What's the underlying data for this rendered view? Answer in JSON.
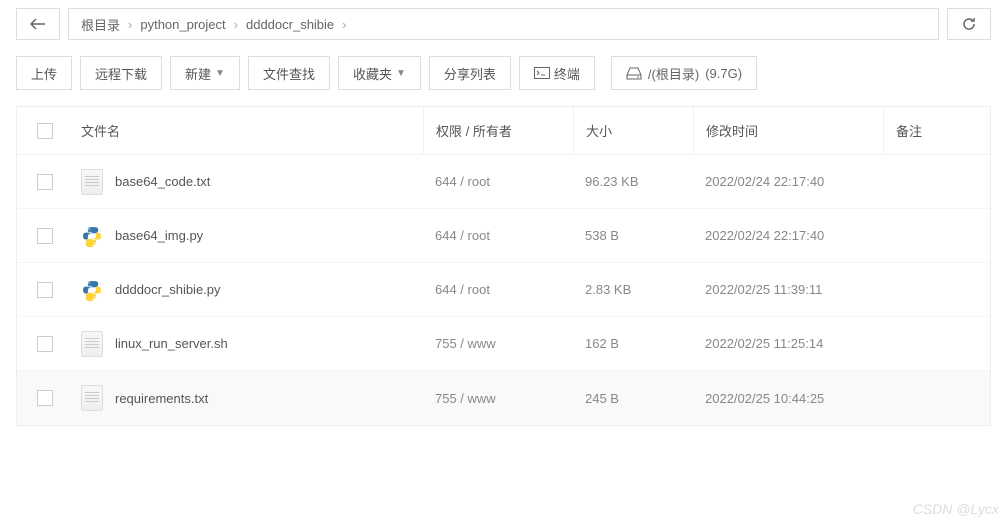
{
  "breadcrumb": {
    "root": "根目录",
    "items": [
      "python_project",
      "ddddocr_shibie"
    ]
  },
  "toolbar": {
    "upload": "上传",
    "remote_download": "远程下载",
    "new": "新建",
    "search": "文件查找",
    "favorites": "收藏夹",
    "share_list": "分享列表",
    "terminal": "终端",
    "disk_path": "/(根目录)",
    "disk_size": "(9.7G)"
  },
  "columns": {
    "name": "文件名",
    "perm": "权限 / 所有者",
    "size": "大小",
    "time": "修改时间",
    "note": "备注"
  },
  "files": [
    {
      "name": "base64_code.txt",
      "icon": "txt",
      "perm": "644 / root",
      "size": "96.23 KB",
      "time": "2022/02/24 22:17:40"
    },
    {
      "name": "base64_img.py",
      "icon": "py",
      "perm": "644 / root",
      "size": "538 B",
      "time": "2022/02/24 22:17:40"
    },
    {
      "name": "ddddocr_shibie.py",
      "icon": "py",
      "perm": "644 / root",
      "size": "2.83 KB",
      "time": "2022/02/25 11:39:11"
    },
    {
      "name": "linux_run_server.sh",
      "icon": "txt",
      "perm": "755 / www",
      "size": "162 B",
      "time": "2022/02/25 11:25:14"
    },
    {
      "name": "requirements.txt",
      "icon": "txt",
      "perm": "755 / www",
      "size": "245 B",
      "time": "2022/02/25 10:44:25"
    }
  ],
  "watermark": "CSDN @Lycx"
}
